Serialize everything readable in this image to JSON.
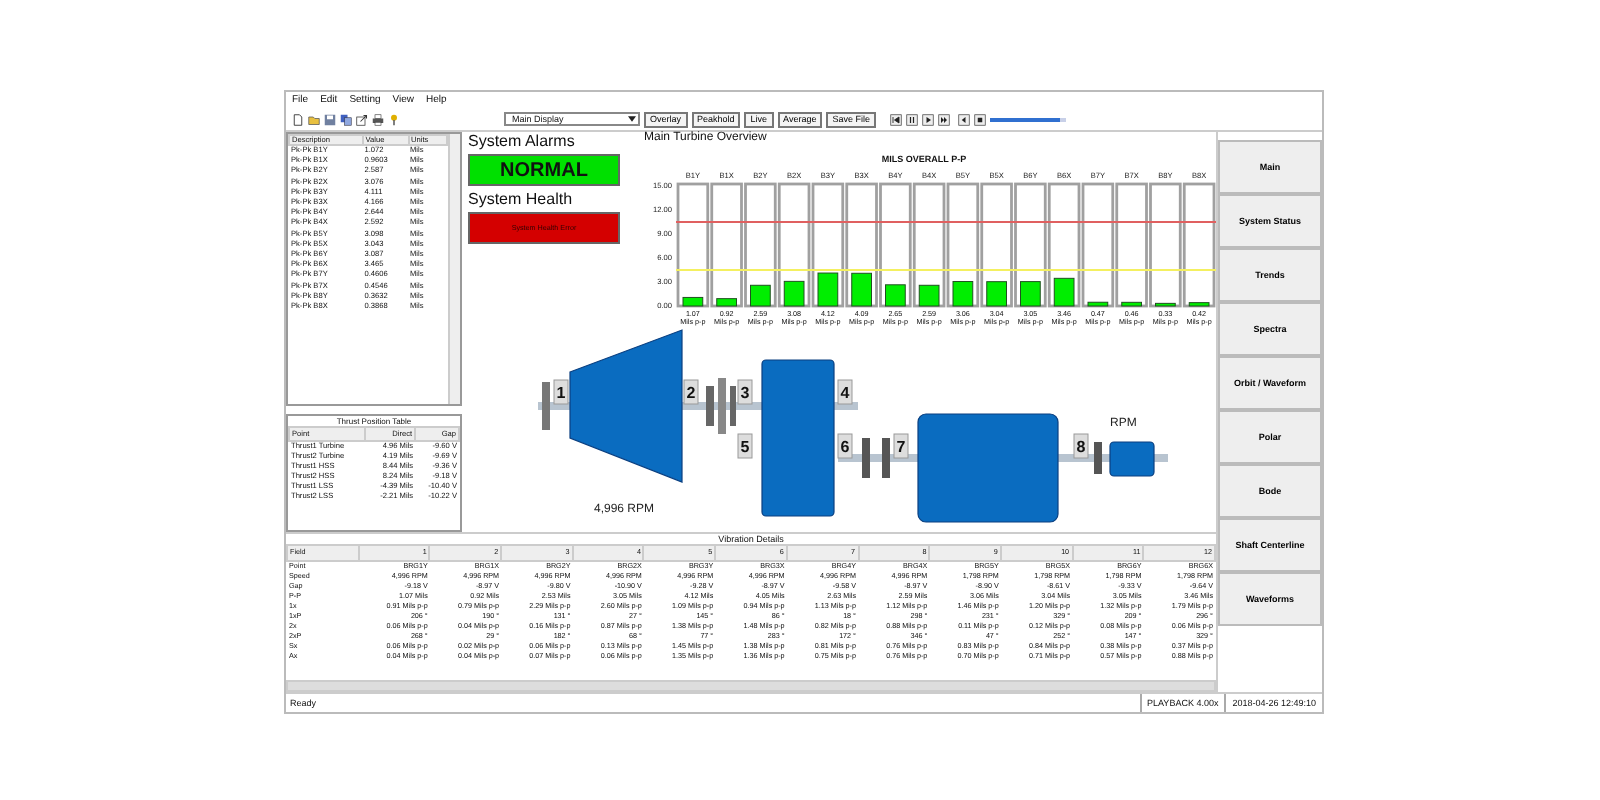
{
  "menu": [
    "File",
    "Edit",
    "Setting",
    "View",
    "Help"
  ],
  "toolbar": {
    "display_select": "Main Display",
    "buttons": [
      "Overlay",
      "Peakhold",
      "Live",
      "Average",
      "Save File"
    ],
    "playback_slider": {
      "level": 0.93
    }
  },
  "point_list": {
    "columns": [
      "Description",
      "Value",
      "Units"
    ],
    "rows": [
      [
        "Pk-Pk B1Y",
        "1.072",
        "Mils"
      ],
      [
        "Pk-Pk B1X",
        "0.9603",
        "Mils"
      ],
      [
        "Pk-Pk B2Y",
        "2.587",
        "Mils"
      ],
      [
        "Pk-Pk B2X",
        "3.076",
        "Mils"
      ],
      [
        "Pk-Pk B3Y",
        "4.111",
        "Mils"
      ],
      [
        "Pk-Pk B3X",
        "4.166",
        "Mils"
      ],
      [
        "Pk-Pk B4Y",
        "2.644",
        "Mils"
      ],
      [
        "Pk-Pk B4X",
        "2.592",
        "Mils"
      ],
      [
        "Pk-Pk B5Y",
        "3.098",
        "Mils"
      ],
      [
        "Pk-Pk B5X",
        "3.043",
        "Mils"
      ],
      [
        "Pk-Pk B6Y",
        "3.087",
        "Mils"
      ],
      [
        "Pk-Pk B6X",
        "3.465",
        "Mils"
      ],
      [
        "Pk-Pk B7Y",
        "0.4606",
        "Mils"
      ],
      [
        "Pk-Pk B7X",
        "0.4546",
        "Mils"
      ],
      [
        "Pk-Pk B8Y",
        "0.3632",
        "Mils"
      ],
      [
        "Pk-Pk B8X",
        "0.3868",
        "Mils"
      ]
    ]
  },
  "thrust_table": {
    "title": "Thrust Position Table",
    "columns": [
      "Point",
      "Direct",
      "Gap"
    ],
    "rows": [
      [
        "Thrust1 Turbine",
        "4.96 Mils",
        "-9.60 V"
      ],
      [
        "Thrust2 Turbine",
        "4.19 Mils",
        "-9.69 V"
      ],
      [
        "Thrust1 HSS",
        "8.44 Mils",
        "-9.36 V"
      ],
      [
        "Thrust2 HSS",
        "8.24 Mils",
        "-9.18 V"
      ],
      [
        "Thrust1 LSS",
        "-4.39 Mils",
        "-10.40 V"
      ],
      [
        "Thrust2 LSS",
        "-2.21 Mils",
        "-10.22 V"
      ]
    ]
  },
  "alarms": {
    "title": "System Alarms",
    "status": {
      "text": "NORMAL",
      "color": "#00e000"
    },
    "health_title": "System Health",
    "health": {
      "text": "System Health Error",
      "color": "#d40000"
    }
  },
  "overview": {
    "title": "Main Turbine Overview",
    "chart_data": {
      "type": "bar",
      "title": "MILS OVERALL P-P",
      "categories": [
        "B1Y",
        "B1X",
        "B2Y",
        "B2X",
        "B3Y",
        "B3X",
        "B4Y",
        "B4X",
        "B5Y",
        "B5X",
        "B6Y",
        "B6X",
        "B7Y",
        "B7X",
        "B8Y",
        "B8X"
      ],
      "values": [
        1.07,
        0.92,
        2.59,
        3.08,
        4.12,
        4.09,
        2.65,
        2.59,
        3.06,
        3.04,
        3.05,
        3.46,
        0.47,
        0.46,
        0.33,
        0.42
      ],
      "ylim": [
        0,
        15
      ],
      "yticks": [
        {
          "value": 0,
          "label": "0.00"
        },
        {
          "value": 3,
          "label": "3.00"
        },
        {
          "value": 6,
          "label": "6.00"
        },
        {
          "value": 9,
          "label": "9.00"
        },
        {
          "value": 12,
          "label": "12.00"
        },
        {
          "value": 15,
          "label": "15.00"
        }
      ],
      "value_labels": [
        "1.07 Mils p-p",
        "0.92 Mils p-p",
        "2.59 Mils p-p",
        "3.08 Mils p-p",
        "4.12 Mils p-p",
        "4.09 Mils p-p",
        "2.65 Mils p-p",
        "2.59 Mils p-p",
        "3.06 Mils p-p",
        "3.04 Mils p-p",
        "3.05 Mils p-p",
        "3.46 Mils p-p",
        "0.47 Mils p-p",
        "0.46 Mils p-p",
        "0.33 Mils p-p",
        "0.42 Mils p-p"
      ],
      "ref_lines": [
        {
          "axis": "y",
          "value": 10.5,
          "color": "#e06060"
        },
        {
          "axis": "y",
          "value": 4.5,
          "color": "#f4f060"
        }
      ]
    },
    "machine": {
      "bearings": [
        "1",
        "2",
        "3",
        "4",
        "5",
        "6",
        "7",
        "8"
      ],
      "speeds": [
        "4,996 RPM",
        "RPM"
      ]
    }
  },
  "vibration": {
    "title": "Vibration Details",
    "columns": [
      "Field",
      "1",
      "2",
      "3",
      "4",
      "5",
      "6",
      "7",
      "8",
      "9",
      "10",
      "11",
      "12"
    ],
    "rows": [
      [
        "Point",
        "BRG1Y",
        "BRG1X",
        "BRG2Y",
        "BRG2X",
        "BRG3Y",
        "BRG3X",
        "BRG4Y",
        "BRG4X",
        "BRG5Y",
        "BRG5X",
        "BRG6Y",
        "BRG6X"
      ],
      [
        "Speed",
        "4,996 RPM",
        "4,996 RPM",
        "4,996 RPM",
        "4,996 RPM",
        "4,996 RPM",
        "4,996 RPM",
        "4,996 RPM",
        "4,996 RPM",
        "1,798 RPM",
        "1,798 RPM",
        "1,798 RPM",
        "1,798 RPM"
      ],
      [
        "Gap",
        "-9.18 V",
        "-8.97 V",
        "-9.80 V",
        "-10.90 V",
        "-9.28 V",
        "-8.97 V",
        "-9.58 V",
        "-8.97 V",
        "-8.90 V",
        "-8.61 V",
        "-9.33 V",
        "-9.64 V"
      ],
      [
        "P-P",
        "1.07 Mils",
        "0.92 Mils",
        "2.53 Mils",
        "3.05 Mils",
        "4.12 Mils",
        "4.05 Mils",
        "2.63 Mils",
        "2.59 Mils",
        "3.06 Mils",
        "3.04 Mils",
        "3.05 Mils",
        "3.46 Mils"
      ],
      [
        "1x",
        "0.91 Mils p-p",
        "0.79 Mils p-p",
        "2.29 Mils p-p",
        "2.60 Mils p-p",
        "1.09 Mils p-p",
        "0.94 Mils p-p",
        "1.13 Mils p-p",
        "1.12 Mils p-p",
        "1.46 Mils p-p",
        "1.20 Mils p-p",
        "1.32 Mils p-p",
        "1.79 Mils p-p"
      ],
      [
        "1xP",
        "206 °",
        "190 °",
        "131 °",
        "27 °",
        "145 °",
        "86 °",
        "18 °",
        "298 °",
        "231 °",
        "329 °",
        "209 °",
        "296 °"
      ],
      [
        "2x",
        "0.06 Mils p-p",
        "0.04 Mils p-p",
        "0.16 Mils p-p",
        "0.87 Mils p-p",
        "1.38 Mils p-p",
        "1.48 Mils p-p",
        "0.82 Mils p-p",
        "0.88 Mils p-p",
        "0.11 Mils p-p",
        "0.12 Mils p-p",
        "0.08 Mils p-p",
        "0.06 Mils p-p"
      ],
      [
        "2xP",
        "268 °",
        "29 °",
        "182 °",
        "68 °",
        "77 °",
        "283 °",
        "172 °",
        "346 °",
        "47 °",
        "252 °",
        "147 °",
        "329 °"
      ],
      [
        "Sx",
        "0.06 Mils p-p",
        "0.02 Mils p-p",
        "0.06 Mils p-p",
        "0.13 Mils p-p",
        "1.45 Mils p-p",
        "1.38 Mils p-p",
        "0.81 Mils p-p",
        "0.76 Mils p-p",
        "0.83 Mils p-p",
        "0.84 Mils p-p",
        "0.38 Mils p-p",
        "0.37 Mils p-p"
      ],
      [
        "Ax",
        "0.04 Mils p-p",
        "0.04 Mils p-p",
        "0.07 Mils p-p",
        "0.06 Mils p-p",
        "1.35 Mils p-p",
        "1.36 Mils p-p",
        "0.75 Mils p-p",
        "0.76 Mils p-p",
        "0.70 Mils p-p",
        "0.71 Mils p-p",
        "0.57 Mils p-p",
        "0.88 Mils p-p"
      ]
    ]
  },
  "nav": [
    "Main",
    "System Status",
    "Trends",
    "Spectra",
    "Orbit / Waveform",
    "Polar",
    "Bode",
    "Shaft Centerline",
    "Waveforms"
  ],
  "status_bar": [
    "Ready",
    "PLAYBACK 4.00x",
    "2018-04-26 12:49:10"
  ]
}
